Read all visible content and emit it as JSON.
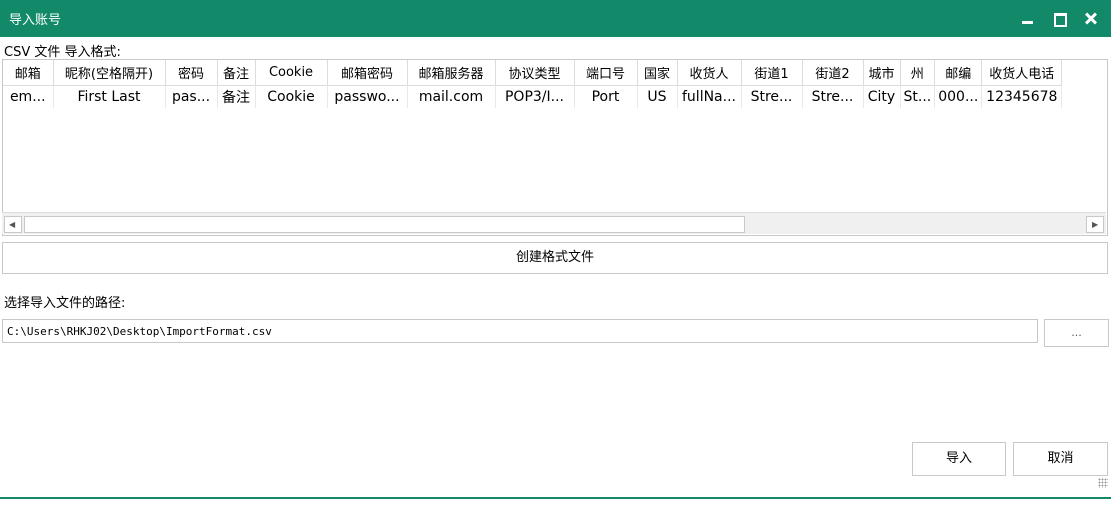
{
  "window": {
    "title": "导入账号"
  },
  "format_label": "CSV 文件 导入格式:",
  "table": {
    "columns": [
      "邮箱",
      "昵称(空格隔开)",
      "密码",
      "备注",
      "Cookie",
      "邮箱密码",
      "邮箱服务器",
      "协议类型",
      "端口号",
      "国家",
      "收货人",
      "街道1",
      "街道2",
      "城市",
      "州",
      "邮编",
      "收货人电话"
    ],
    "rows": [
      [
        "em...",
        "First Last",
        "pas...",
        "备注",
        "Cookie",
        "passwo...",
        "mail.com",
        "POP3/I...",
        "Port",
        "US",
        "fullNa...",
        "Stre...",
        "Stre...",
        "City",
        "St...",
        "000...",
        "12345678"
      ]
    ]
  },
  "create_button": "创建格式文件",
  "path_label": "选择导入文件的路径:",
  "path_value": "C:\\Users\\RHKJ02\\Desktop\\ImportFormat.csv",
  "browse_label": "...",
  "ok_button": "导入",
  "cancel_button": "取消",
  "colors": {
    "titlebar": "#128a6a"
  }
}
